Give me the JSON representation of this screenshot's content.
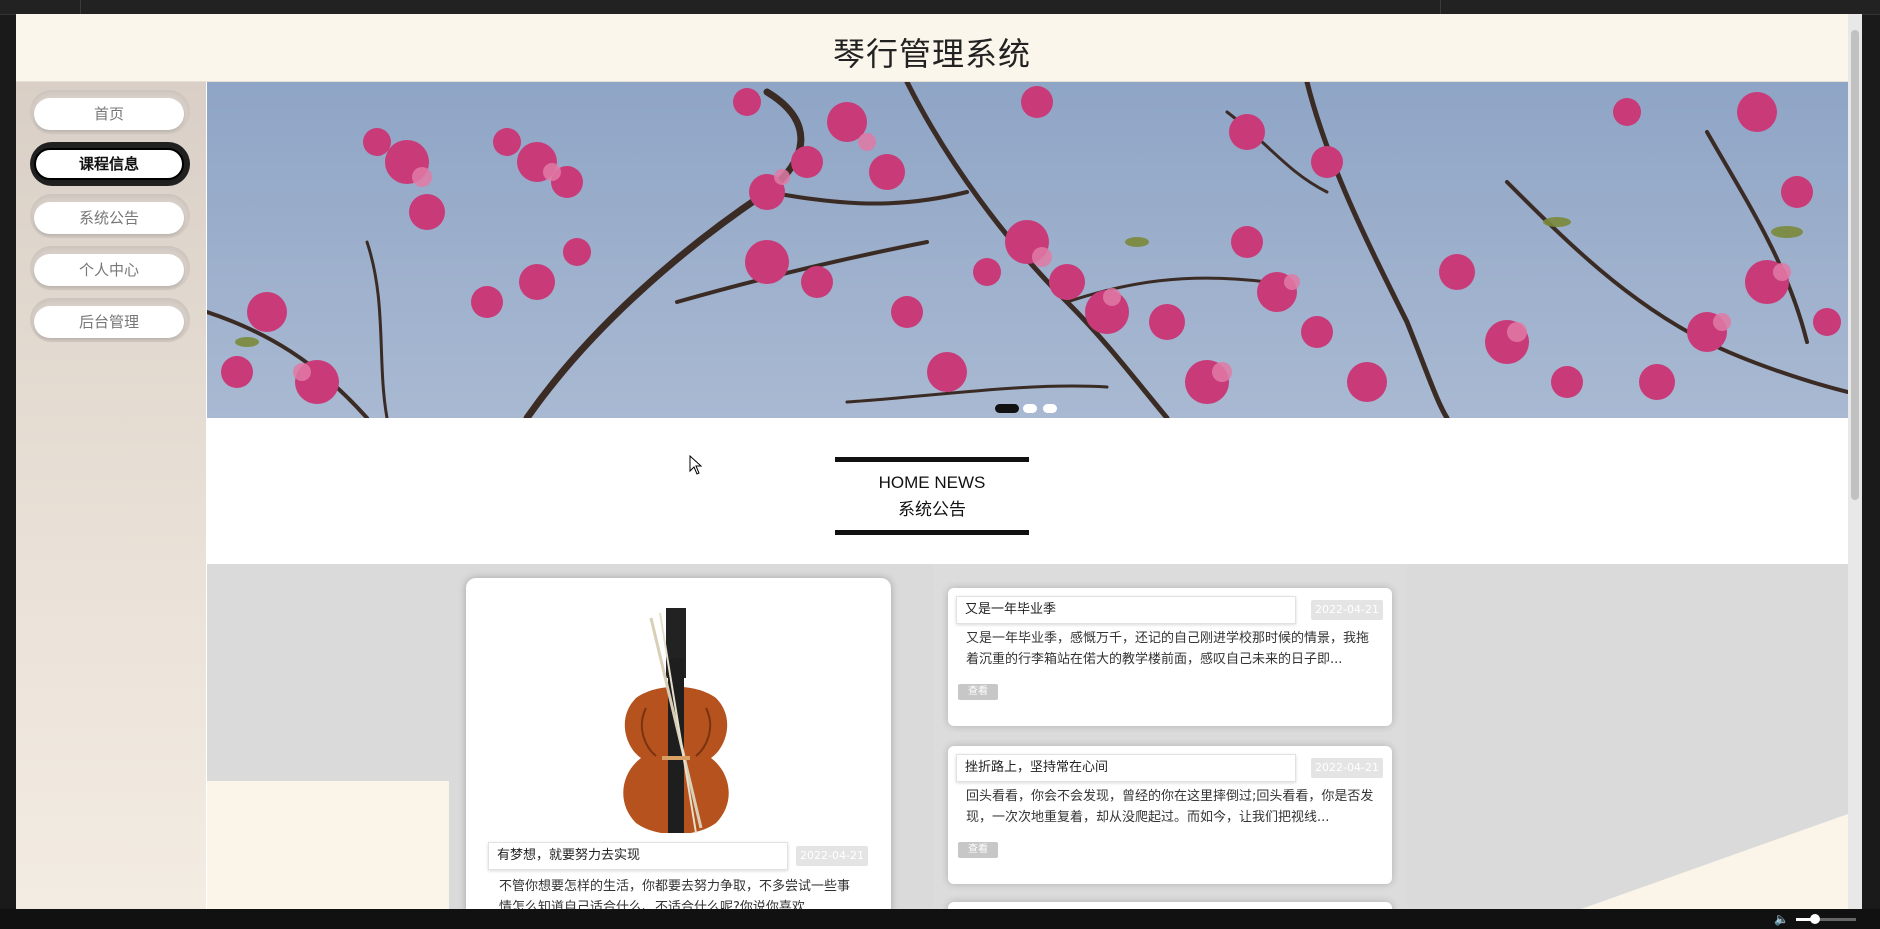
{
  "site": {
    "title": "琴行管理系统"
  },
  "sidebar": {
    "items": [
      {
        "label": "首页",
        "active": false
      },
      {
        "label": "课程信息",
        "active": true
      },
      {
        "label": "系统公告",
        "active": false
      },
      {
        "label": "个人中心",
        "active": false
      },
      {
        "label": "后台管理",
        "active": false
      }
    ]
  },
  "banner": {
    "slide_count": 3,
    "active_slide": 1
  },
  "news": {
    "heading_en": "HOME NEWS",
    "heading_cn": "系统公告",
    "featured": {
      "title": "有梦想，就要努力去实现",
      "date": "2022-04-21",
      "desc": "不管你想要怎样的生活，你都要去努力争取，不多尝试一些事情怎么知道自己适合什么、不适合什么呢?你说你喜欢..."
    },
    "items": [
      {
        "title": "又是一年毕业季",
        "date": "2022-04-21",
        "desc": "又是一年毕业季，感慨万千，还记的自己刚进学校那时候的情景，我拖着沉重的行李箱站在偌大的教学楼前面，感叹自己未来的日子即...",
        "more": "查看"
      },
      {
        "title": "挫折路上，坚持常在心间",
        "date": "2022-04-21",
        "desc": "回头看看，你会不会发现，曾经的你在这里摔倒过;回头看看，你是否发现，一次次地重复着，却从没爬起过。而如今，让我们把视线...",
        "more": "查看"
      }
    ]
  },
  "colors": {
    "header_bg": "#fbf6ec",
    "sidebar_bg": "#d9cfc6",
    "content_bg": "#dadada",
    "accent": "#111111"
  },
  "icons": {
    "cursor": "mouse-pointer-icon",
    "volume": "speaker-muted-icon"
  },
  "player": {
    "volume_level": 0.32
  }
}
